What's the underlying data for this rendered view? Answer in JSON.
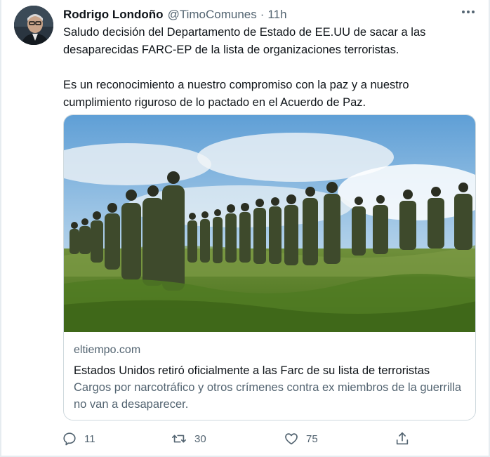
{
  "tweet": {
    "author_name": "Rodrigo Londoño",
    "handle": "@TimoComunes",
    "separator": "·",
    "time": "11h",
    "paragraphs": [
      "Saludo decisión del Departamento de Estado de EE.UU de sacar a las desaparecidas FARC-EP de la lista de organizaciones terroristas.",
      "Es un reconocimiento a nuestro compromiso con la paz y a nuestro cumplimiento riguroso de lo pactado en el Acuerdo de Paz."
    ]
  },
  "card": {
    "domain": "eltiempo.com",
    "title": "Estados Unidos retiró oficialmente a las Farc de su lista de terroristas",
    "description": "Cargos por narcotráfico y otros crímenes contra ex miembros de la guerrilla no van a desaparecer."
  },
  "actions": {
    "replies": "11",
    "retweets": "30",
    "likes": "75"
  },
  "icons": {
    "more": "more-horizontal-icon",
    "reply": "reply-icon",
    "retweet": "retweet-icon",
    "like": "heart-icon",
    "share": "share-icon"
  },
  "colors": {
    "text_primary": "#0f1419",
    "text_secondary": "#536471",
    "border": "#cfd9de"
  }
}
